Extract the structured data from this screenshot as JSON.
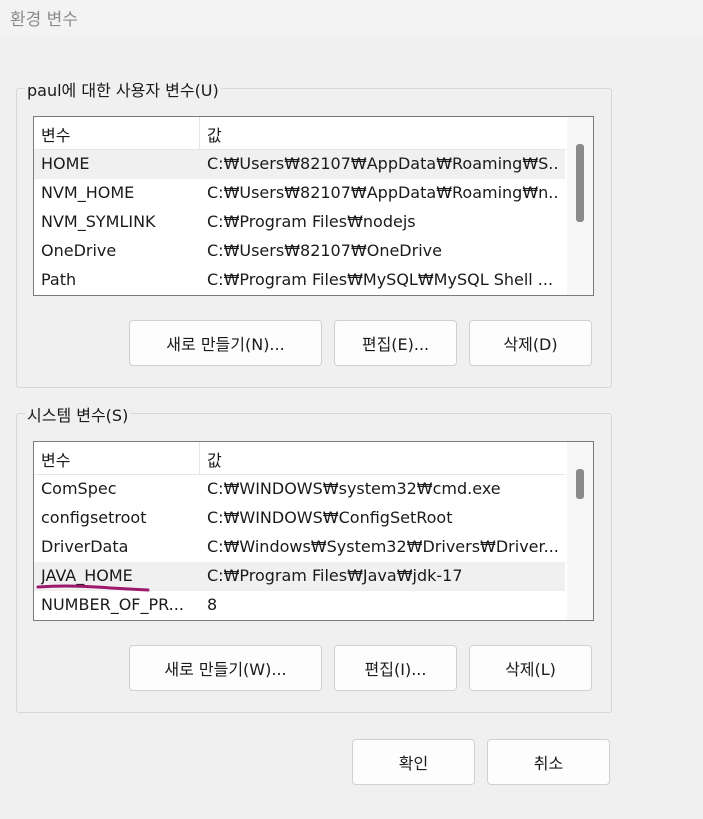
{
  "window": {
    "title": "환경 변수"
  },
  "user_group": {
    "label": "paul에 대한 사용자 변수(U)",
    "header": {
      "name": "변수",
      "value": "값"
    },
    "rows": [
      {
        "name": "HOME",
        "value": "C:₩Users₩82107₩AppData₩Roaming₩S..."
      },
      {
        "name": "NVM_HOME",
        "value": "C:₩Users₩82107₩AppData₩Roaming₩n..."
      },
      {
        "name": "NVM_SYMLINK",
        "value": "C:₩Program Files₩nodejs"
      },
      {
        "name": "OneDrive",
        "value": "C:₩Users₩82107₩OneDrive"
      },
      {
        "name": "Path",
        "value": "C:₩Program Files₩MySQL₩MySQL Shell ..."
      }
    ],
    "buttons": {
      "new": "새로 만들기(N)...",
      "edit": "편집(E)...",
      "delete": "삭제(D)"
    }
  },
  "system_group": {
    "label": "시스템 변수(S)",
    "header": {
      "name": "변수",
      "value": "값"
    },
    "rows": [
      {
        "name": "ComSpec",
        "value": "C:₩WINDOWS₩system32₩cmd.exe"
      },
      {
        "name": "configsetroot",
        "value": "C:₩WINDOWS₩ConfigSetRoot"
      },
      {
        "name": "DriverData",
        "value": "C:₩Windows₩System32₩Drivers₩Driver..."
      },
      {
        "name": "JAVA_HOME",
        "value": "C:₩Program Files₩Java₩jdk-17"
      },
      {
        "name": "NUMBER_OF_PR...",
        "value": "8"
      }
    ],
    "buttons": {
      "new": "새로 만들기(W)...",
      "edit": "편집(I)...",
      "delete": "삭제(L)"
    }
  },
  "footer": {
    "ok": "확인",
    "cancel": "취소"
  },
  "colors": {
    "highlight_underline": "#9c1a6b"
  }
}
